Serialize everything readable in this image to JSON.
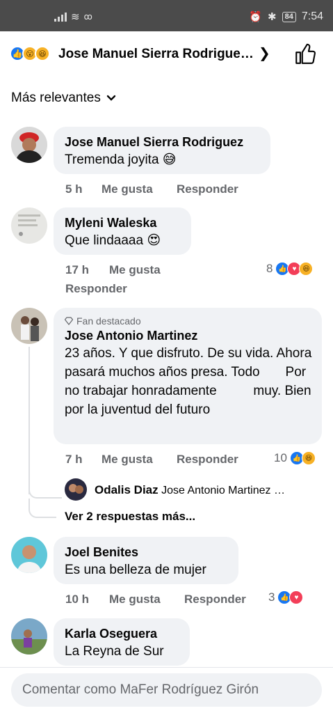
{
  "status_bar": {
    "time": "7:54",
    "battery": "84"
  },
  "header": {
    "title": "Jose Manuel Sierra Rodrigue…",
    "reaction_icons": [
      "like-icon",
      "wow-icon",
      "haha-icon"
    ]
  },
  "sort": {
    "label": "Más relevantes"
  },
  "comments": [
    {
      "name": "Jose Manuel Sierra Rodriguez",
      "text": "Tremenda joyita 😅",
      "time": "5 h",
      "like": "Me gusta",
      "reply": "Responder"
    },
    {
      "name": "Myleni Waleska",
      "text": "Que lindaaaa 😍",
      "time": "17 h",
      "like": "Me gusta",
      "reply": "Responder",
      "reaction_count": "8"
    },
    {
      "badge": "Fan destacado",
      "name": "Jose Antonio Martinez",
      "text": "23 años. Y que disfruto. De su vida. Ahora pasará muchos años presa. Todo       Por no trabajar honradamente          muy. Bien por la juventud del futuro",
      "time": "7 h",
      "like": "Me gusta",
      "reply": "Responder",
      "reaction_count": "10",
      "reply_preview": {
        "name": "Odalis Diaz",
        "text": "Jose Antonio Martinez …"
      },
      "more_replies": "Ver 2 respuestas más..."
    },
    {
      "name": "Joel Benites",
      "text": "Es una belleza de mujer",
      "time": "10 h",
      "like": "Me gusta",
      "reply": "Responder",
      "reaction_count": "3"
    },
    {
      "name": "Karla Oseguera",
      "text": "La Reyna de Sur"
    }
  ],
  "composer": {
    "placeholder": "Comentar como MaFer Rodríguez Girón"
  },
  "colors": {
    "like": "#1877f2",
    "love": "#f33e58",
    "haha": "#f7b125",
    "bubble": "#f0f2f5",
    "meta": "#65676b"
  }
}
